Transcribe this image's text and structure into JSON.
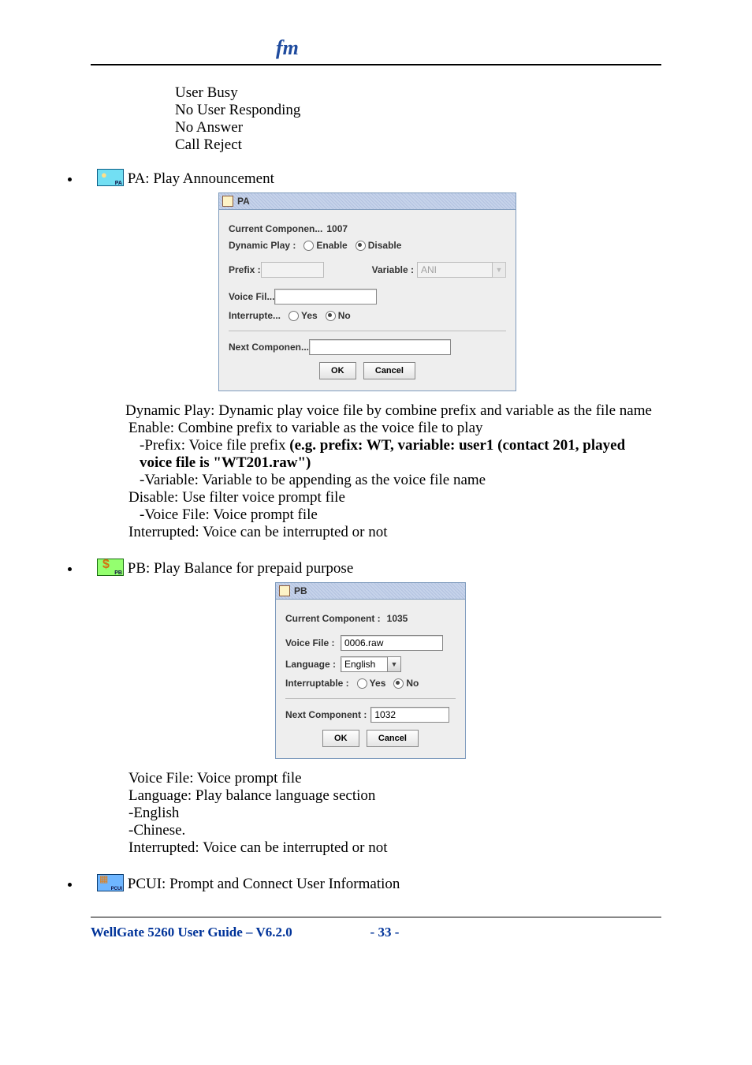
{
  "logo": "fm",
  "body": {
    "busy_lines": [
      "User Busy",
      "No User Responding",
      "No Answer",
      "Call Reject"
    ],
    "pa_title": "PA: Play Announcement",
    "pa_dialog": {
      "title": "PA",
      "current_label": "Current Componen...",
      "current_value": "1007",
      "dynplay_label": "Dynamic Play :",
      "enable": "Enable",
      "disable": "Disable",
      "prefix_label": "Prefix :",
      "prefix_value": "",
      "variable_label": "Variable :",
      "variable_value": "ANI",
      "voicefile_label": "Voice Fil...",
      "voicefile_value": "",
      "interrupt_label": "Interrupte...",
      "yes": "Yes",
      "no": "No",
      "next_label": "Next Componen...",
      "next_value": "",
      "ok": "OK",
      "cancel": "Cancel"
    },
    "pa_desc_dyn_prefix": " Dynamic Play: Dynamic play voice file by combine prefix and variable as the file name",
    "pa_desc_enable": " Enable: Combine prefix to variable as the voice file to play",
    "pa_desc_prefix": "-Prefix: Voice file prefix ",
    "pa_desc_prefix_bold": "(e.g. prefix: WT, variable: user1 (contact 201, played voice file is \"WT201.raw\")",
    "pa_desc_variable": "-Variable: Variable to be appending as the voice file name",
    "pa_desc_disable": "Disable: Use filter voice prompt file",
    "pa_desc_voicefile": "-Voice File: Voice prompt file",
    "pa_desc_interrupt": "Interrupted: Voice can be interrupted or not",
    "pb_title": "PB: Play Balance for prepaid purpose",
    "pb_dialog": {
      "title": "PB",
      "current_label": "Current Component :",
      "current_value": "1035",
      "voicefile_label": "Voice File :",
      "voicefile_value": "0006.raw",
      "language_label": "Language :",
      "language_value": "English",
      "interrupt_label": "Interruptable :",
      "yes": "Yes",
      "no": "No",
      "next_label": "Next Component :",
      "next_value": "1032",
      "ok": "OK",
      "cancel": "Cancel"
    },
    "pb_desc_voicefile": "Voice File: Voice prompt file",
    "pb_desc_language": "Language: Play balance language section",
    "pb_desc_english": " -English",
    "pb_desc_chinese": " -Chinese.",
    "pb_desc_interrupt": "Interrupted: Voice can be interrupted or not",
    "pcui_title": "PCUI: Prompt and Connect User Information"
  },
  "footer": {
    "title": "WellGate 5260 User Guide – V6.2.0",
    "page": "- 33 -"
  }
}
